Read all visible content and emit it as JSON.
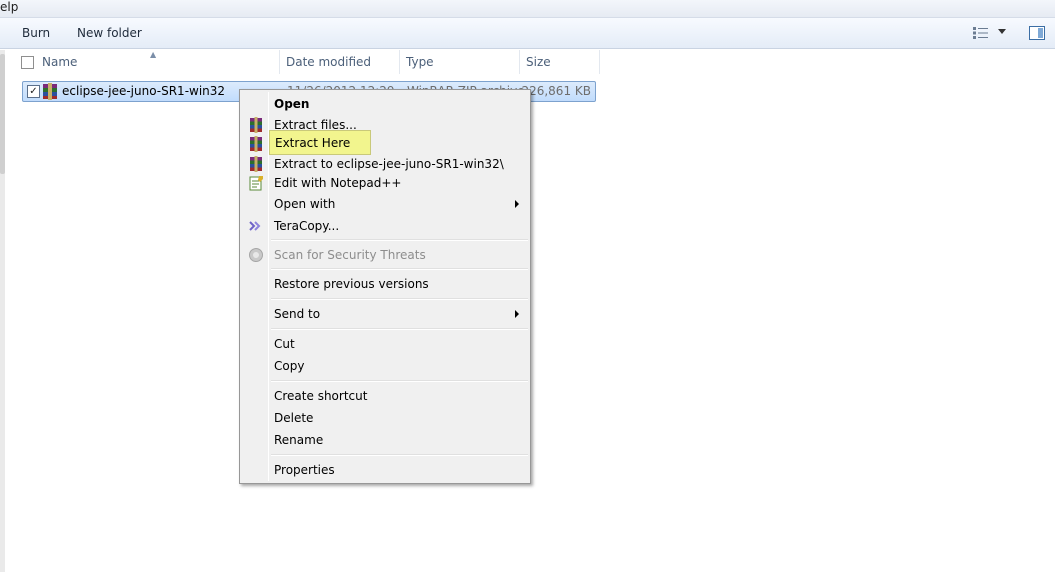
{
  "menubar": {
    "partial_text": "elp"
  },
  "toolbar": {
    "burn": "Burn",
    "new_folder": "New folder"
  },
  "columns": {
    "name": "Name",
    "date": "Date modified",
    "type": "Type",
    "size": "Size"
  },
  "file": {
    "name": "eclipse-jee-juno-SR1-win32",
    "date": "11/26/2012 12:29",
    "type": "WinRAR ZIP archive",
    "size": "226,861 KB",
    "checked_mark": "✓"
  },
  "context_menu": {
    "open": "Open",
    "extract_files": "Extract files...",
    "extract_here": "Extract Here",
    "extract_to": "Extract to eclipse-jee-juno-SR1-win32\\",
    "edit_notepad": "Edit with Notepad++",
    "open_with": "Open with",
    "teracopy": "TeraCopy...",
    "scan": "Scan for Security Threats",
    "restore": "Restore previous versions",
    "send_to": "Send to",
    "cut": "Cut",
    "copy": "Copy",
    "create_shortcut": "Create shortcut",
    "delete": "Delete",
    "rename": "Rename",
    "properties": "Properties"
  },
  "tooltip": {
    "text": "Extract Here"
  },
  "colors": {
    "selection": "#c1dcfc",
    "tooltip_bg": "#f2f58e",
    "menu_bg": "#f0f0f0"
  }
}
